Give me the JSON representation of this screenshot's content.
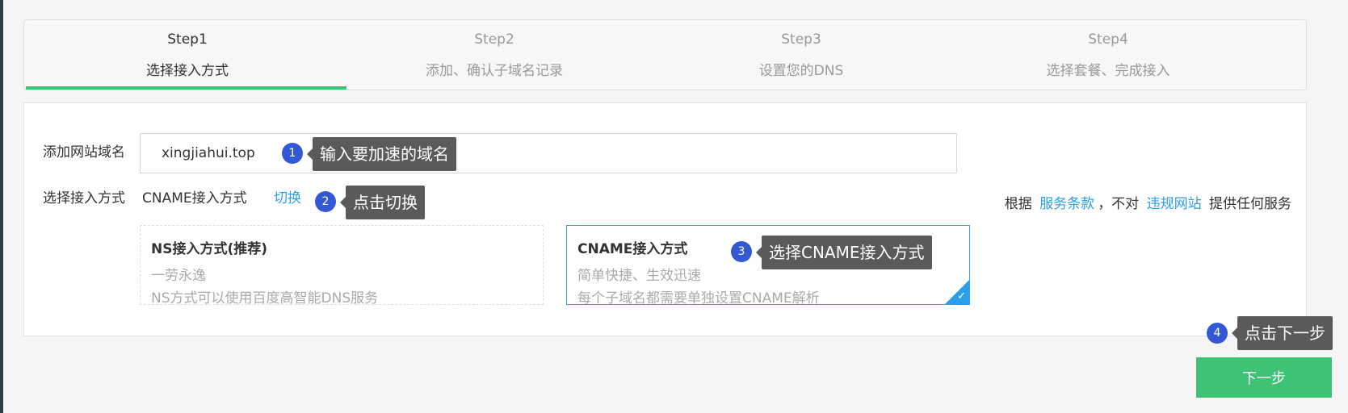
{
  "steps": [
    {
      "num": "Step1",
      "title": "选择接入方式"
    },
    {
      "num": "Step2",
      "title": "添加、确认子域名记录"
    },
    {
      "num": "Step3",
      "title": "设置您的DNS"
    },
    {
      "num": "Step4",
      "title": "选择套餐、完成接入"
    }
  ],
  "progress": {
    "completed_fraction": 0.25
  },
  "form": {
    "domain_label": "添加网站域名",
    "domain_value": "xingjiahui.top",
    "method_label": "选择接入方式",
    "method_value": "CNAME接入方式",
    "switch_link": "切换"
  },
  "terms": {
    "prefix": "根据",
    "link1": "服务条款",
    "middle": "，不对",
    "link2": "违规网站",
    "suffix": "提供任何服务"
  },
  "options": [
    {
      "title": "NS接入方式(推荐)",
      "desc1": "一劳永逸",
      "desc2": "NS方式可以使用百度高智能DNS服务"
    },
    {
      "title": "CNAME接入方式",
      "desc1": "简单快捷、生效迅速",
      "desc2": "每个子域名都需要单独设置CNAME解析"
    }
  ],
  "annotations": [
    {
      "number": "1",
      "text": "输入要加速的域名"
    },
    {
      "number": "2",
      "text": "点击切换"
    },
    {
      "number": "3",
      "text": "选择CNAME接入方式"
    },
    {
      "number": "4",
      "text": "点击下一步"
    }
  ],
  "next_button": "下一步",
  "colors": {
    "accent_green": "#3ec376",
    "link_blue": "#2d9ee8",
    "badge_blue": "#3358d4"
  }
}
